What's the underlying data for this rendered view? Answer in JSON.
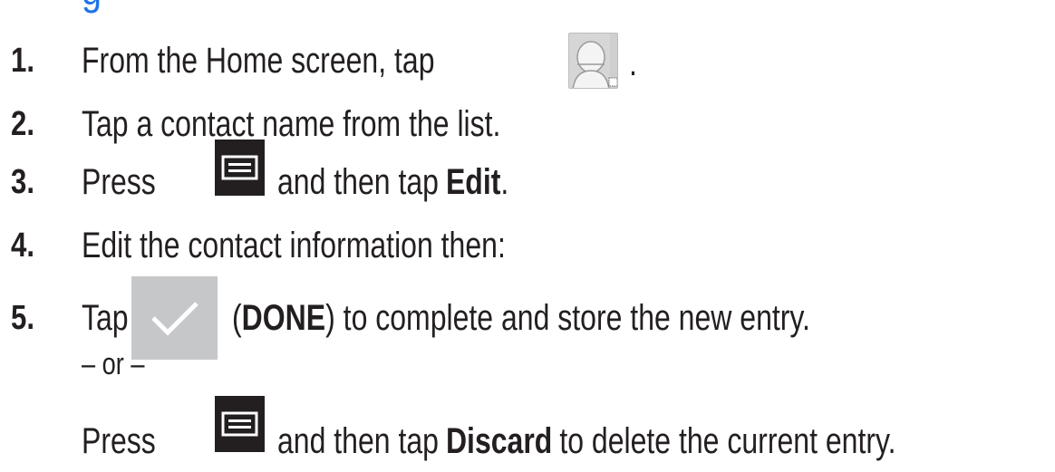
{
  "heading_fragment": "g",
  "steps": [
    {
      "num": "1.",
      "text_a": "From the Home screen, tap",
      "text_b": "."
    },
    {
      "num": "2.",
      "text_a": "Tap a contact name from the list."
    },
    {
      "num": "3.",
      "text_a": "Press",
      "text_b": "and then tap",
      "bold_b": "Edit",
      "text_c": "."
    },
    {
      "num": "4.",
      "text_a": "Edit the contact information then:"
    },
    {
      "num": "5.",
      "text_a": "Tap",
      "paren_open": "(",
      "bold_b": "DONE",
      "text_c": ") to complete and store the new entry."
    }
  ],
  "or_separator": "– or –",
  "alt_step": {
    "text_a": "Press",
    "text_b": "and then tap",
    "bold_b": "Discard",
    "text_c": "to delete the current entry."
  },
  "icons": {
    "contacts": "contacts-app-icon",
    "menu": "menu-key-icon",
    "done": "checkmark-icon"
  },
  "colors": {
    "text": "#231f20",
    "heading": "#1e73e8",
    "menu_key": "#231f20",
    "done_button": "#c6c7c9"
  }
}
